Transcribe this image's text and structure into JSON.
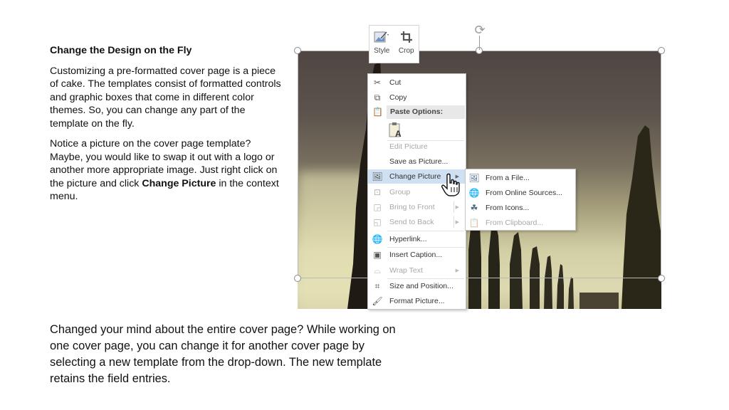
{
  "left_text": {
    "heading": "Change the Design on the Fly",
    "para1": "Customizing a pre-formatted cover page is a piece of cake. The templates consist of formatted controls and graphic boxes that come in different color themes. So, you can change any part of the template on the fly.",
    "para2_before": "Notice a picture on the cover page template? Maybe, you would like to swap it out with a logo or another more appropriate image. Just right click on the picture and click ",
    "para2_bold": "Change Picture",
    "para2_after": " in the context menu."
  },
  "bottom_text": "Changed your mind about the entire cover page? While working on one cover page, you can change it for another cover page by selecting a new template from the drop-down. The new template retains the field entries.",
  "mini_toolbar": {
    "style_label": "Style",
    "crop_label": "Crop"
  },
  "context_menu": {
    "items": [
      {
        "label": "Cut",
        "icon": "scissors-icon",
        "enabled": true
      },
      {
        "label": "Copy",
        "icon": "copy-icon",
        "enabled": true
      },
      {
        "label": "Paste Options:",
        "icon": "paste-icon",
        "enabled": true
      },
      {
        "label": "Edit Picture",
        "enabled": false
      },
      {
        "label": "Save as Picture...",
        "enabled": true
      },
      {
        "label": "Change Picture",
        "icon": "change-picture-icon",
        "enabled": true,
        "submenu": true,
        "highlighted": true
      },
      {
        "label": "Group",
        "icon": "group-icon",
        "enabled": false,
        "submenu": true
      },
      {
        "label": "Bring to Front",
        "icon": "bring-to-front-icon",
        "enabled": false,
        "submenu": true
      },
      {
        "label": "Send to Back",
        "icon": "send-to-back-icon",
        "enabled": false,
        "submenu": true
      },
      {
        "label": "Hyperlink...",
        "icon": "hyperlink-icon",
        "enabled": true
      },
      {
        "label": "Insert Caption...",
        "icon": "insert-caption-icon",
        "enabled": true
      },
      {
        "label": "Wrap Text",
        "icon": "wrap-text-icon",
        "enabled": false,
        "submenu": true
      },
      {
        "label": "Size and Position...",
        "icon": "size-position-icon",
        "enabled": true
      },
      {
        "label": "Format Picture...",
        "icon": "format-picture-icon",
        "enabled": true
      }
    ]
  },
  "submenu": {
    "items": [
      {
        "label": "From a File...",
        "enabled": true
      },
      {
        "label": "From Online Sources...",
        "enabled": true
      },
      {
        "label": "From Icons...",
        "enabled": true
      },
      {
        "label": "From Clipboard...",
        "enabled": false
      }
    ]
  },
  "colors": {
    "highlight": "#cfe0f3",
    "disabled_text": "#a8a8a8"
  }
}
